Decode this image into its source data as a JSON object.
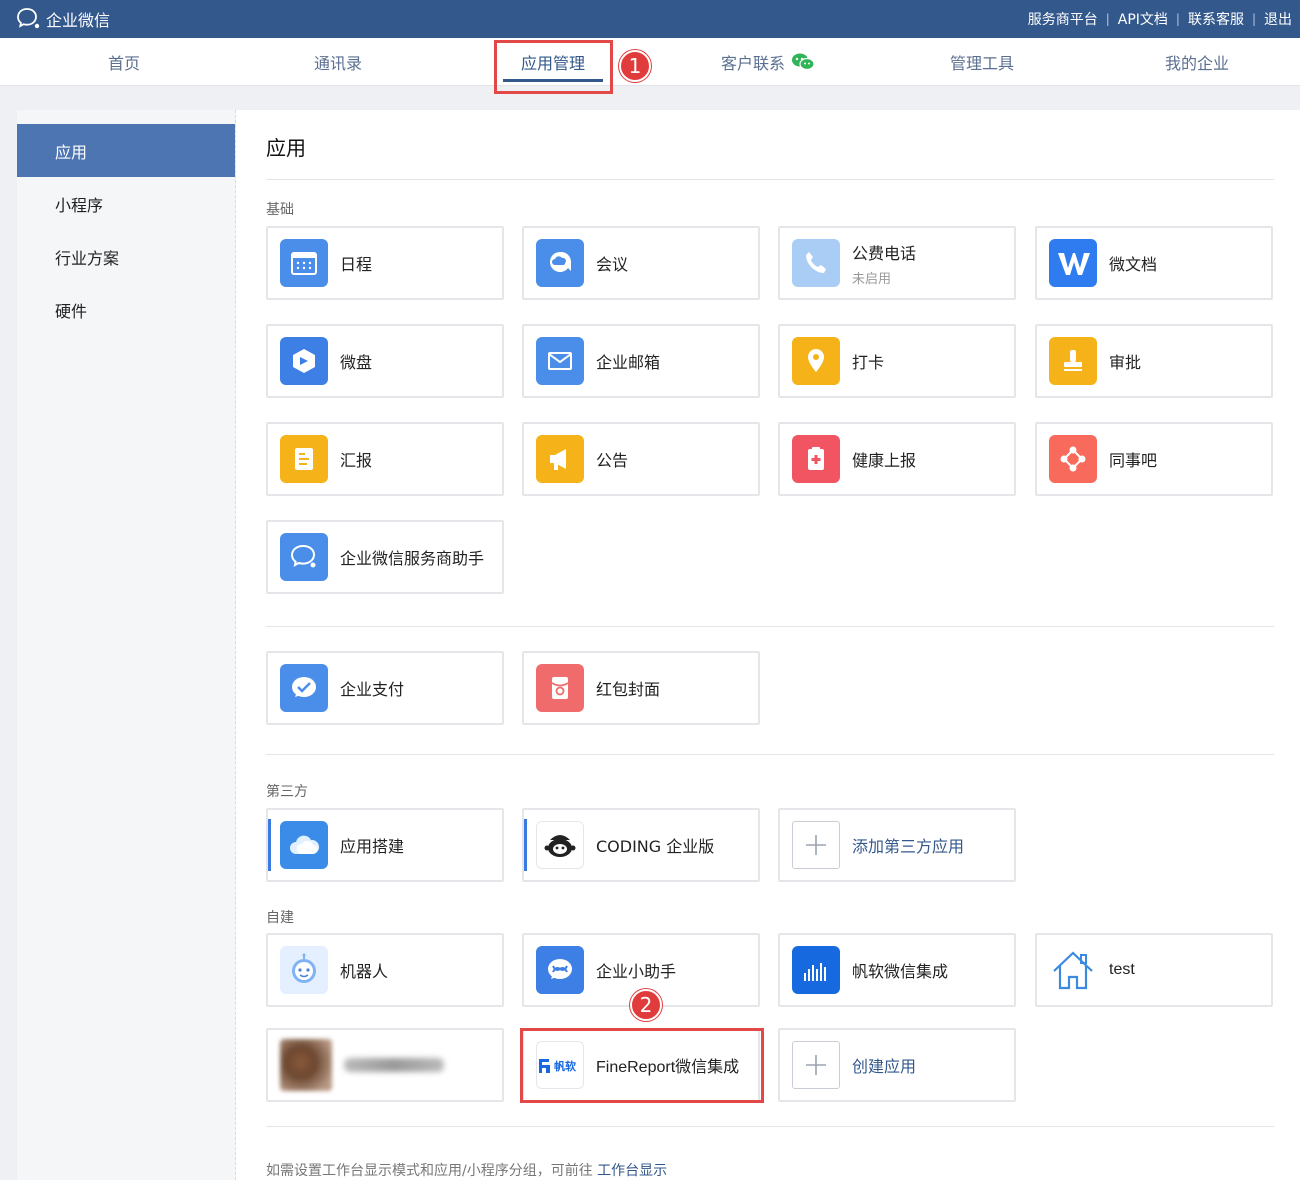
{
  "topbar": {
    "brand": "企业微信",
    "links": [
      "服务商平台",
      "API文档",
      "联系客服",
      "退出"
    ]
  },
  "nav": {
    "items": [
      "首页",
      "通讯录",
      "应用管理",
      "客户联系",
      "管理工具",
      "我的企业"
    ],
    "active_index": 2
  },
  "markers": [
    "1",
    "2"
  ],
  "sidebar": {
    "items": [
      "应用",
      "小程序",
      "行业方案",
      "硬件"
    ],
    "active_index": 0
  },
  "content": {
    "title": "应用",
    "section_basic": "基础",
    "section_third": "第三方",
    "section_custom": "自建",
    "basic_apps": [
      {
        "name": "日程",
        "icon": "calendar-icon"
      },
      {
        "name": "会议",
        "icon": "meeting-icon"
      },
      {
        "name": "公费电话",
        "sub": "未启用",
        "icon": "phone-icon"
      },
      {
        "name": "微文档",
        "icon": "doc-icon"
      },
      {
        "name": "微盘",
        "icon": "disk-icon"
      },
      {
        "name": "企业邮箱",
        "icon": "mail-icon"
      },
      {
        "name": "打卡",
        "icon": "checkin-icon"
      },
      {
        "name": "审批",
        "icon": "approval-icon"
      },
      {
        "name": "汇报",
        "icon": "report-icon"
      },
      {
        "name": "公告",
        "icon": "announce-icon"
      },
      {
        "name": "健康上报",
        "icon": "health-icon"
      },
      {
        "name": "同事吧",
        "icon": "colleague-icon"
      },
      {
        "name": "企业微信服务商助手",
        "icon": "service-assistant-icon"
      }
    ],
    "pay_apps": [
      {
        "name": "企业支付",
        "icon": "pay-icon"
      },
      {
        "name": "红包封面",
        "icon": "redpacket-icon"
      }
    ],
    "third_apps": [
      {
        "name": "应用搭建",
        "icon": "cloud-icon"
      },
      {
        "name": "CODING 企业版",
        "icon": "coding-icon"
      },
      {
        "name": "添加第三方应用",
        "icon": "plus-icon"
      }
    ],
    "custom_apps": [
      {
        "name": "机器人",
        "icon": "robot-icon"
      },
      {
        "name": "企业小助手",
        "icon": "assistant-icon"
      },
      {
        "name": "帆软微信集成",
        "icon": "fanruan-chart-icon"
      },
      {
        "name": "test",
        "icon": "house-icon"
      },
      {
        "name": "FineReport微信集成",
        "icon": "fanruan-logo-icon"
      },
      {
        "name": "创建应用",
        "icon": "plus-icon"
      }
    ],
    "fanruan_logo_text": "帆软",
    "footer_text": "如需设置工作台显示模式和应用/小程序分组，可前往",
    "footer_link": "工作台显示"
  },
  "colors": {
    "topbar": "#33588c",
    "accent": "#4c75b1",
    "highlight": "#e24848"
  }
}
